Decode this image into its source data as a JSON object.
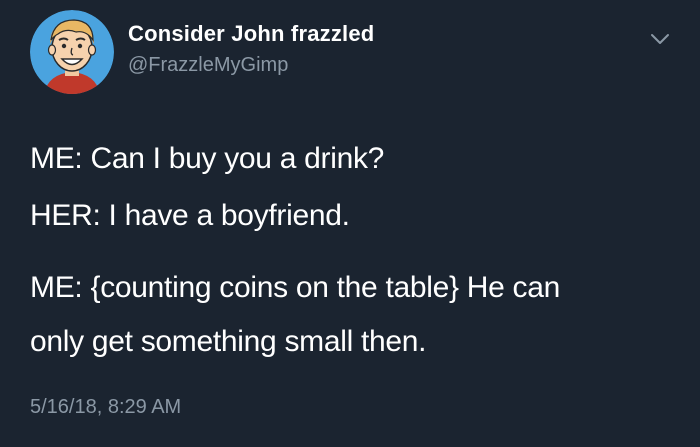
{
  "tweet": {
    "display_name": "Consider John frazzled",
    "handle": "@FrazzleMyGimp",
    "lines": [
      "ME: Can I buy you a drink?",
      "HER: I have a boyfriend.",
      "ME: {counting coins on the table} He can",
      "only get something small then."
    ],
    "timestamp": "5/16/18, 8:29 AM"
  },
  "icons": {
    "avatar": "cartoon-face-avatar",
    "menu": "chevron-down-icon"
  },
  "colors": {
    "background": "#1b2430",
    "text": "#ffffff",
    "muted": "#8b98a5",
    "avatar_ring": "#4aa3df"
  }
}
